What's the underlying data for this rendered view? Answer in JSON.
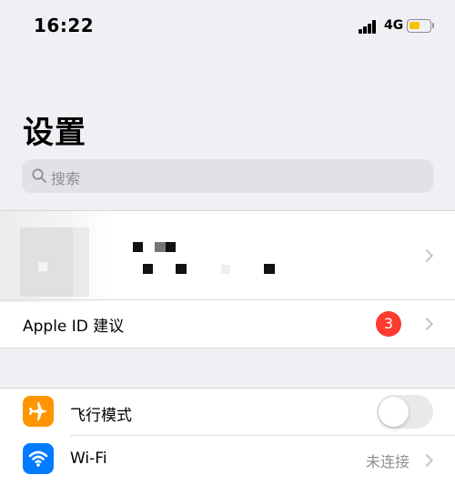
{
  "status_bar": {
    "time": "16:22",
    "network_type": "4G",
    "icons": [
      "cellular-signal-icon",
      "battery-icon"
    ],
    "battery_color": "#f5c400"
  },
  "header": {
    "title": "设置"
  },
  "search": {
    "placeholder": "搜索",
    "icon": "search-icon"
  },
  "account": {
    "avatar_icon": "avatar-icon",
    "profile_name": "",
    "apple_id_suggestions": {
      "label": "Apple ID 建议",
      "badge_count": "3",
      "badge_color": "#ff3b30"
    }
  },
  "settings": {
    "items": [
      {
        "label": "飞行模式",
        "icon": "airplane-icon",
        "icon_bg": "#ff9500",
        "control": "toggle",
        "toggle_on": false
      },
      {
        "label": "Wi-Fi",
        "icon": "wifi-icon",
        "icon_bg": "#007aff",
        "value": "未连接",
        "control": "chevron"
      }
    ]
  }
}
